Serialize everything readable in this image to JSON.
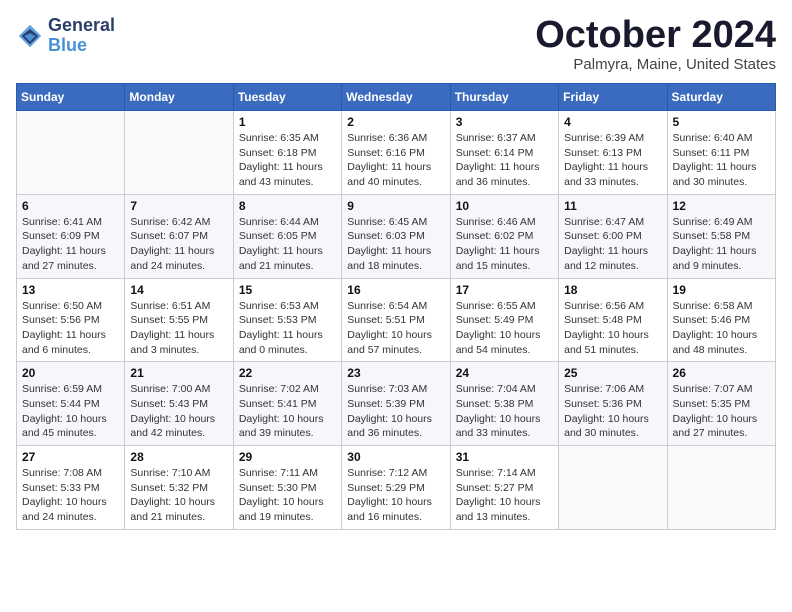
{
  "header": {
    "logo_line1": "General",
    "logo_line2": "Blue",
    "month_title": "October 2024",
    "location": "Palmyra, Maine, United States"
  },
  "weekdays": [
    "Sunday",
    "Monday",
    "Tuesday",
    "Wednesday",
    "Thursday",
    "Friday",
    "Saturday"
  ],
  "weeks": [
    [
      {
        "day": "",
        "info": ""
      },
      {
        "day": "",
        "info": ""
      },
      {
        "day": "1",
        "info": "Sunrise: 6:35 AM\nSunset: 6:18 PM\nDaylight: 11 hours and 43 minutes."
      },
      {
        "day": "2",
        "info": "Sunrise: 6:36 AM\nSunset: 6:16 PM\nDaylight: 11 hours and 40 minutes."
      },
      {
        "day": "3",
        "info": "Sunrise: 6:37 AM\nSunset: 6:14 PM\nDaylight: 11 hours and 36 minutes."
      },
      {
        "day": "4",
        "info": "Sunrise: 6:39 AM\nSunset: 6:13 PM\nDaylight: 11 hours and 33 minutes."
      },
      {
        "day": "5",
        "info": "Sunrise: 6:40 AM\nSunset: 6:11 PM\nDaylight: 11 hours and 30 minutes."
      }
    ],
    [
      {
        "day": "6",
        "info": "Sunrise: 6:41 AM\nSunset: 6:09 PM\nDaylight: 11 hours and 27 minutes."
      },
      {
        "day": "7",
        "info": "Sunrise: 6:42 AM\nSunset: 6:07 PM\nDaylight: 11 hours and 24 minutes."
      },
      {
        "day": "8",
        "info": "Sunrise: 6:44 AM\nSunset: 6:05 PM\nDaylight: 11 hours and 21 minutes."
      },
      {
        "day": "9",
        "info": "Sunrise: 6:45 AM\nSunset: 6:03 PM\nDaylight: 11 hours and 18 minutes."
      },
      {
        "day": "10",
        "info": "Sunrise: 6:46 AM\nSunset: 6:02 PM\nDaylight: 11 hours and 15 minutes."
      },
      {
        "day": "11",
        "info": "Sunrise: 6:47 AM\nSunset: 6:00 PM\nDaylight: 11 hours and 12 minutes."
      },
      {
        "day": "12",
        "info": "Sunrise: 6:49 AM\nSunset: 5:58 PM\nDaylight: 11 hours and 9 minutes."
      }
    ],
    [
      {
        "day": "13",
        "info": "Sunrise: 6:50 AM\nSunset: 5:56 PM\nDaylight: 11 hours and 6 minutes."
      },
      {
        "day": "14",
        "info": "Sunrise: 6:51 AM\nSunset: 5:55 PM\nDaylight: 11 hours and 3 minutes."
      },
      {
        "day": "15",
        "info": "Sunrise: 6:53 AM\nSunset: 5:53 PM\nDaylight: 11 hours and 0 minutes."
      },
      {
        "day": "16",
        "info": "Sunrise: 6:54 AM\nSunset: 5:51 PM\nDaylight: 10 hours and 57 minutes."
      },
      {
        "day": "17",
        "info": "Sunrise: 6:55 AM\nSunset: 5:49 PM\nDaylight: 10 hours and 54 minutes."
      },
      {
        "day": "18",
        "info": "Sunrise: 6:56 AM\nSunset: 5:48 PM\nDaylight: 10 hours and 51 minutes."
      },
      {
        "day": "19",
        "info": "Sunrise: 6:58 AM\nSunset: 5:46 PM\nDaylight: 10 hours and 48 minutes."
      }
    ],
    [
      {
        "day": "20",
        "info": "Sunrise: 6:59 AM\nSunset: 5:44 PM\nDaylight: 10 hours and 45 minutes."
      },
      {
        "day": "21",
        "info": "Sunrise: 7:00 AM\nSunset: 5:43 PM\nDaylight: 10 hours and 42 minutes."
      },
      {
        "day": "22",
        "info": "Sunrise: 7:02 AM\nSunset: 5:41 PM\nDaylight: 10 hours and 39 minutes."
      },
      {
        "day": "23",
        "info": "Sunrise: 7:03 AM\nSunset: 5:39 PM\nDaylight: 10 hours and 36 minutes."
      },
      {
        "day": "24",
        "info": "Sunrise: 7:04 AM\nSunset: 5:38 PM\nDaylight: 10 hours and 33 minutes."
      },
      {
        "day": "25",
        "info": "Sunrise: 7:06 AM\nSunset: 5:36 PM\nDaylight: 10 hours and 30 minutes."
      },
      {
        "day": "26",
        "info": "Sunrise: 7:07 AM\nSunset: 5:35 PM\nDaylight: 10 hours and 27 minutes."
      }
    ],
    [
      {
        "day": "27",
        "info": "Sunrise: 7:08 AM\nSunset: 5:33 PM\nDaylight: 10 hours and 24 minutes."
      },
      {
        "day": "28",
        "info": "Sunrise: 7:10 AM\nSunset: 5:32 PM\nDaylight: 10 hours and 21 minutes."
      },
      {
        "day": "29",
        "info": "Sunrise: 7:11 AM\nSunset: 5:30 PM\nDaylight: 10 hours and 19 minutes."
      },
      {
        "day": "30",
        "info": "Sunrise: 7:12 AM\nSunset: 5:29 PM\nDaylight: 10 hours and 16 minutes."
      },
      {
        "day": "31",
        "info": "Sunrise: 7:14 AM\nSunset: 5:27 PM\nDaylight: 10 hours and 13 minutes."
      },
      {
        "day": "",
        "info": ""
      },
      {
        "day": "",
        "info": ""
      }
    ]
  ]
}
